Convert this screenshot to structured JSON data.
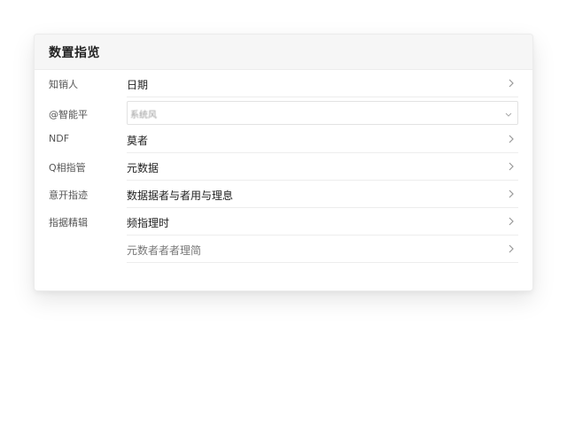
{
  "panel": {
    "title": "数置指览"
  },
  "rows": [
    {
      "label": "知销人",
      "value": "日期"
    },
    {
      "label": "@智能平",
      "select_value": "系统风"
    },
    {
      "label": "NDF",
      "value": "莫者"
    },
    {
      "label": "Q相指管",
      "value": "元数据"
    },
    {
      "label": "意开指迹",
      "value": "数据据者与者用与理息"
    },
    {
      "label": "指据精辑",
      "value": "频指理时"
    },
    {
      "label": "",
      "value": "元数者者者理简"
    }
  ],
  "icons": {
    "row_chevron": "chevron-right-icon",
    "select_chevron": "chevron-down-icon"
  }
}
